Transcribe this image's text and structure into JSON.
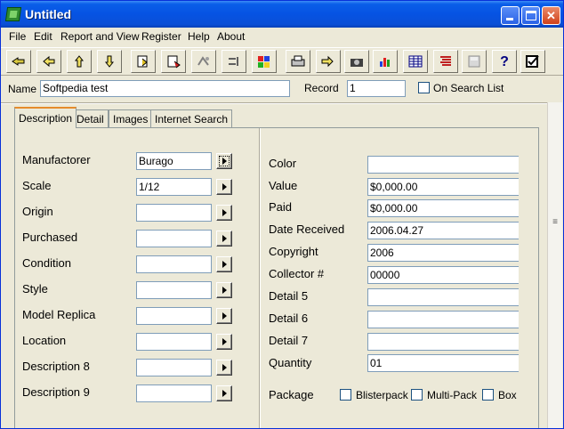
{
  "window": {
    "title": "Untitled"
  },
  "menu": [
    "File",
    "Edit",
    "Report and View",
    "Register",
    "Help",
    "About"
  ],
  "toolbar": {
    "buttons": [
      "first-record-icon",
      "previous-record-icon",
      "next-record-icon",
      "last-record-icon",
      "add-record-icon",
      "delete-record-icon",
      "find-icon",
      "sort-icon",
      "colors-icon",
      "print-icon",
      "print-preview-icon",
      "camera-icon",
      "chart-icon",
      "table-icon",
      "report-icon",
      "save-icon",
      "help-icon",
      "checkmark-icon"
    ]
  },
  "record": {
    "name_label": "Name",
    "name_value": "Softpedia test",
    "record_label": "Record",
    "record_value": "1",
    "on_search_list_label": "On Search List",
    "on_search_list_checked": false
  },
  "tabs": [
    "Description",
    "Detail",
    "Images",
    "Internet Search"
  ],
  "active_tab": "Description",
  "left_fields": [
    {
      "label": "Manufactorer",
      "value": "Burago"
    },
    {
      "label": "Scale",
      "value": "1/12"
    },
    {
      "label": "Origin",
      "value": ""
    },
    {
      "label": "Purchased",
      "value": ""
    },
    {
      "label": "Condition",
      "value": ""
    },
    {
      "label": "Style",
      "value": ""
    },
    {
      "label": "Model Replica",
      "value": ""
    },
    {
      "label": "Location",
      "value": ""
    },
    {
      "label": "Description 8",
      "value": ""
    },
    {
      "label": "Description 9",
      "value": ""
    }
  ],
  "right_fields": [
    {
      "label": "Color",
      "value": ""
    },
    {
      "label": "Value",
      "value": "$0,000.00"
    },
    {
      "label": "Paid",
      "value": "$0,000.00"
    },
    {
      "label": "Date Received",
      "value": "2006.04.27"
    },
    {
      "label": "Copyright",
      "value": "2006"
    },
    {
      "label": "Collector #",
      "value": "00000"
    },
    {
      "label": "Detail 5",
      "value": ""
    },
    {
      "label": "Detail 6",
      "value": ""
    },
    {
      "label": "Detail 7",
      "value": ""
    },
    {
      "label": "Quantity",
      "value": "01"
    }
  ],
  "package": {
    "label": "Package",
    "options": [
      {
        "label": "Blisterpack",
        "checked": false
      },
      {
        "label": "Multi-Pack",
        "checked": false
      },
      {
        "label": "Box",
        "checked": false
      }
    ]
  }
}
